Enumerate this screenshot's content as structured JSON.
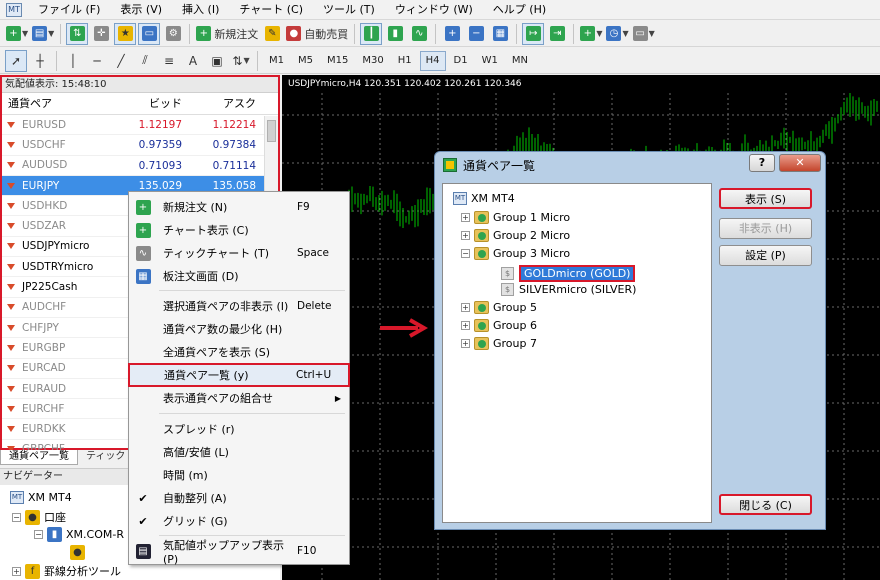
{
  "menubar": {
    "app_icon": "mt4-icon",
    "items": [
      "ファイル (F)",
      "表示 (V)",
      "挿入 (I)",
      "チャート (C)",
      "ツール (T)",
      "ウィンドウ (W)",
      "ヘルプ (H)"
    ]
  },
  "toolbar": {
    "new_order_label": "新規注文",
    "auto_trade_label": "自動売買",
    "draw_text_label": "A",
    "timeframes": [
      "M1",
      "M5",
      "M15",
      "M30",
      "H1",
      "H4",
      "D1",
      "W1",
      "MN"
    ],
    "active_timeframe": "H4"
  },
  "market_watch": {
    "header": "気配値表示: 15:48:10",
    "columns": {
      "symbol": "通貨ペア",
      "bid": "ビッド",
      "ask": "アスク"
    },
    "rows": [
      {
        "symbol": "EURUSD",
        "bid": "1.12197",
        "ask": "1.12214",
        "dim": true,
        "color": "red"
      },
      {
        "symbol": "USDCHF",
        "bid": "0.97359",
        "ask": "0.97384",
        "dim": true,
        "color": "blue"
      },
      {
        "symbol": "AUDUSD",
        "bid": "0.71093",
        "ask": "0.71114",
        "dim": true,
        "color": "blue"
      },
      {
        "symbol": "EURJPY",
        "bid": "135.029",
        "ask": "135.058",
        "selected": true
      },
      {
        "symbol": "USDHKD",
        "dim": true
      },
      {
        "symbol": "USDZAR",
        "dim": true
      },
      {
        "symbol": "USDJPYmicro"
      },
      {
        "symbol": "USDTRYmicro"
      },
      {
        "symbol": "JP225Cash"
      },
      {
        "symbol": "AUDCHF",
        "dim": true
      },
      {
        "symbol": "CHFJPY",
        "dim": true
      },
      {
        "symbol": "EURGBP",
        "dim": true
      },
      {
        "symbol": "EURCAD",
        "dim": true
      },
      {
        "symbol": "EURAUD",
        "dim": true
      },
      {
        "symbol": "EURCHF",
        "dim": true
      },
      {
        "symbol": "EURDKK",
        "dim": true
      },
      {
        "symbol": "GBPCHF",
        "dim": true
      }
    ],
    "tabs": [
      "通貨ペア一覧",
      "ティック"
    ]
  },
  "navigator": {
    "header": "ナビゲーター",
    "root": "XM MT4",
    "accounts": "口座",
    "server": "XM.COM-R",
    "indicators": "罫線分析ツール"
  },
  "chart": {
    "label": "USDJPYmicro,H4  120.351 120.402 120.261 120.346",
    "background": "#000000",
    "candle_color": "#00c400",
    "grid_color": "#6a6a6a"
  },
  "context_menu": {
    "items": [
      {
        "label": "新規注文 (N)",
        "shortcut": "F9",
        "icon": "new-order-icon"
      },
      {
        "label": "チャート表示 (C)",
        "shortcut": "",
        "icon": "chart-window-icon"
      },
      {
        "label": "ティックチャート (T)",
        "shortcut": "Space",
        "icon": "tick-chart-icon"
      },
      {
        "label": "板注文画面 (D)",
        "shortcut": "",
        "icon": "order-book-icon"
      },
      {
        "label": "選択通貨ペアの非表示 (I)",
        "shortcut": "Delete"
      },
      {
        "label": "通貨ペア数の最少化 (H)",
        "shortcut": ""
      },
      {
        "label": "全通貨ペアを表示 (S)",
        "shortcut": ""
      },
      {
        "label": "通貨ペア一覧 (y)",
        "shortcut": "Ctrl+U",
        "highlighted": true
      },
      {
        "label": "表示通貨ペアの組合せ",
        "shortcut": "",
        "submenu": true
      },
      {
        "label": "スプレッド (r)",
        "shortcut": ""
      },
      {
        "label": "高値/安値 (L)",
        "shortcut": ""
      },
      {
        "label": "時間 (m)",
        "shortcut": ""
      },
      {
        "label": "自動整列 (A)",
        "shortcut": "",
        "checked": true
      },
      {
        "label": "グリッド (G)",
        "shortcut": "",
        "checked": true
      },
      {
        "label": "気配値ポップアップ表示 (P)",
        "shortcut": "F10",
        "icon": "popup-icon"
      }
    ]
  },
  "dialog": {
    "title": "通貨ペア一覧",
    "help": "?",
    "close": "✕",
    "tree_root": "XM MT4",
    "groups": [
      "Group 1 Micro",
      "Group 2 Micro",
      "Group 3 Micro"
    ],
    "group3_children": [
      "GOLDmicro (GOLD)",
      "SILVERmicro (SILVER)"
    ],
    "more_groups": [
      "Group 5",
      "Group 6",
      "Group 7"
    ],
    "buttons": {
      "show": "表示 (S)",
      "hide": "非表示 (H)",
      "settings": "設定 (P)",
      "close": "閉じる (C)"
    }
  },
  "colors": {
    "highlight_red": "#d8182a",
    "selection_blue": "#3d8ee6",
    "bid_red": "#d8182a",
    "bid_blue": "#1a2f9a"
  }
}
